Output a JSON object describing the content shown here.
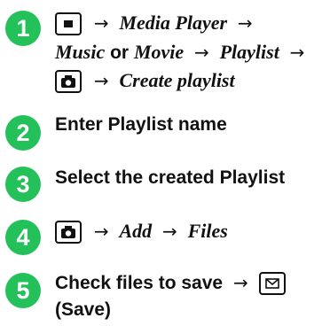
{
  "steps": [
    {
      "number": "1",
      "line1": {
        "arrow1": "→",
        "media_player": "Media Player",
        "arrow2": "→"
      },
      "line2": {
        "music": "Music",
        "or": "or",
        "movie": "Movie",
        "arrow1": "→",
        "playlist": "Playlist",
        "arrow2": "→"
      },
      "line3": {
        "arrow": "→",
        "create_playlist": "Create playlist"
      }
    },
    {
      "number": "2",
      "text": "Enter Playlist name"
    },
    {
      "number": "3",
      "text": "Select the created Playlist"
    },
    {
      "number": "4",
      "arrow1": "→",
      "add": "Add",
      "arrow2": "→",
      "files": "Files"
    },
    {
      "number": "5",
      "text": "Check files to save",
      "arrow": "→",
      "save_paren": "(Save)"
    }
  ],
  "icons": {
    "menu_key": "menu-key-icon",
    "camera_key": "camera-key-icon",
    "mail_key": "mail-key-icon"
  },
  "colors": {
    "badge": "#24c15a",
    "text": "#111111"
  }
}
